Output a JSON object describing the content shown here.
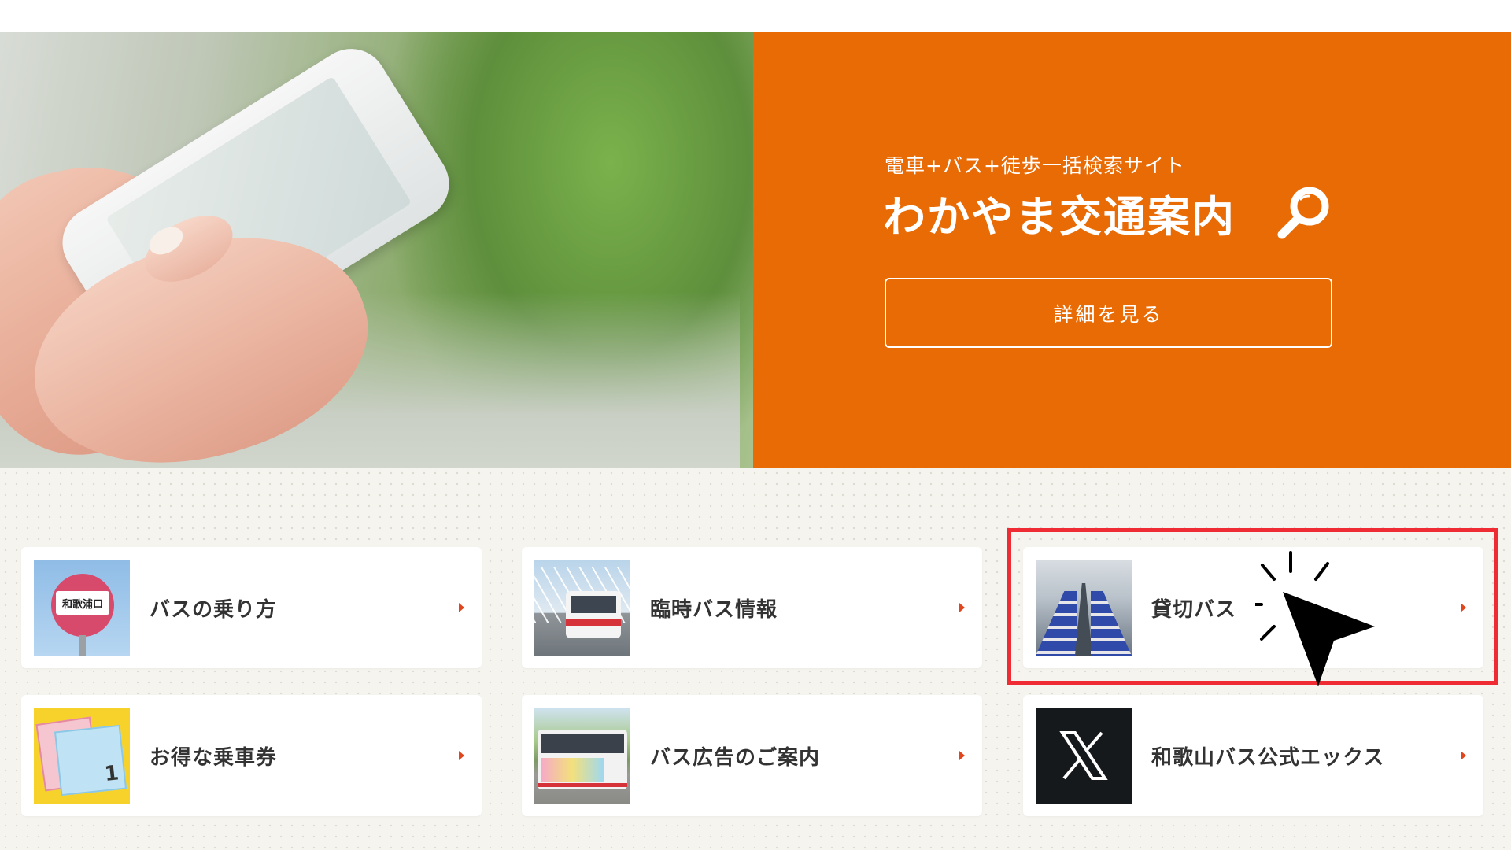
{
  "hero": {
    "subtitle": "電車+バス+徒歩一括検索サイト",
    "title": "わかやま交通案内",
    "search_icon": "search-icon",
    "detail_button_label": "詳細を見る",
    "panel_color": "#e96b06"
  },
  "cards": [
    {
      "label": "バスの乗り方",
      "thumb_text": "和歌浦口",
      "icon": "bus-stop-image"
    },
    {
      "label": "臨時バス情報",
      "icon": "bus-bridge-image"
    },
    {
      "label": "貸切バス",
      "icon": "bus-interior-image"
    },
    {
      "label": "お得な乗車券",
      "thumb_text": "1",
      "icon": "ticket-image"
    },
    {
      "label": "バス広告のご案内",
      "icon": "ad-bus-image"
    },
    {
      "label": "和歌山バス公式エックス",
      "icon": "x-logo"
    }
  ],
  "highlight_color": "#ef2b33",
  "arrow_color": "#e2451b"
}
